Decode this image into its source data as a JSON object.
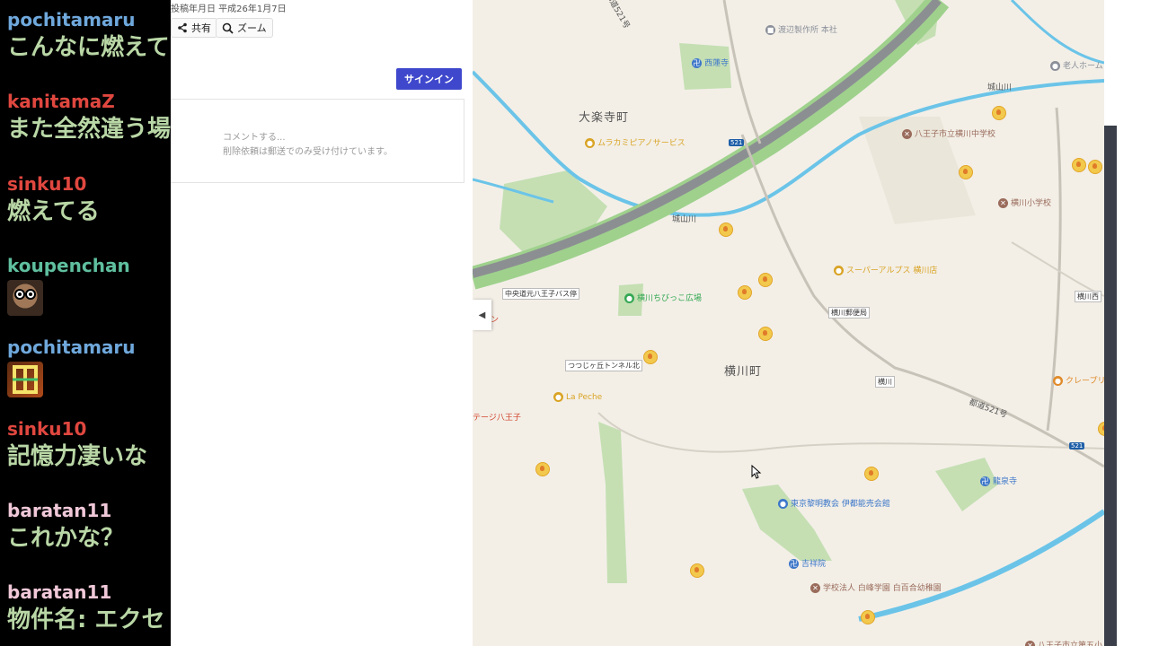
{
  "chat": {
    "messages": [
      {
        "user": "pochitamaru",
        "color": "#6fa8dc",
        "text": "こんなに燃えて"
      },
      {
        "user": "kanitamaZ",
        "color": "#e0473f",
        "text": "また全然違う場"
      },
      {
        "user": "sinku10",
        "color": "#e0473f",
        "text": "燃えてる"
      },
      {
        "user": "koupenchan",
        "color": "#5fbf9f",
        "emote": "face-emote"
      },
      {
        "user": "pochitamaru",
        "color": "#6fa8dc",
        "emote": "kanji-emote"
      },
      {
        "user": "sinku10",
        "color": "#e0473f",
        "text": "記憶力凄いな"
      },
      {
        "user": "baratan11",
        "color": "#f0c8d8",
        "text": "これかな？"
      },
      {
        "user": "baratan11",
        "color": "#f0c8d8",
        "text": "物件名: エクセ"
      }
    ]
  },
  "panel": {
    "date_text": "投稿年月日 平成26年1月7日",
    "share_label": "共有",
    "zoom_label": "ズーム",
    "signin_label": "サインイン",
    "comment_placeholder": "コメントする...",
    "comment_note": "削除依頼は郵送でのみ受け付けています。"
  },
  "map": {
    "areas": [
      "大楽寺町",
      "横川町"
    ],
    "roads": [
      "都道521号",
      "城山川",
      "城山川",
      "都道521号"
    ],
    "shields": [
      "521",
      "521"
    ],
    "bus_stops": [
      "中央道元八王子バス停",
      "つつじヶ丘トンネル北",
      "横川郵便局",
      "横川",
      "横川西"
    ],
    "pois": [
      {
        "name": "渡辺製作所 本社",
        "color": "#8a8f99",
        "glyph": "■"
      },
      {
        "name": "西蓮寺",
        "color": "#3d77c9",
        "glyph": "卍"
      },
      {
        "name": "老人ホーム",
        "color": "#8a8f99",
        "glyph": "●"
      },
      {
        "name": "ムラカミピアノサービス",
        "color": "#d9a324",
        "glyph": "●"
      },
      {
        "name": "八王子市立横川中学校",
        "color": "#9a6b5b",
        "glyph": "✕"
      },
      {
        "name": "横川小学校",
        "color": "#9a6b5b",
        "glyph": "✕"
      },
      {
        "name": "スーパーアルプス 横川店",
        "color": "#d9a324",
        "glyph": "●"
      },
      {
        "name": "横川ちびっこ広場",
        "color": "#34a853",
        "glyph": "●"
      },
      {
        "name": "クレープリ",
        "color": "#e08a2a",
        "glyph": "●"
      },
      {
        "name": "La Peche",
        "color": "#d9a324",
        "glyph": "●"
      },
      {
        "name": "テージ八王子",
        "color": "#d3452e",
        "glyph": ""
      },
      {
        "name": "龍泉寺",
        "color": "#3d77c9",
        "glyph": "卍"
      },
      {
        "name": "東京黎明教会 伊都能売会館",
        "color": "#3d77c9",
        "glyph": "●"
      },
      {
        "name": "吉祥院",
        "color": "#3d77c9",
        "glyph": "卍"
      },
      {
        "name": "学校法人 白峰学園 白百合幼稚園",
        "color": "#9a6b5b",
        "glyph": "✕"
      },
      {
        "name": "八王子市立第五小",
        "color": "#9a6b5b",
        "glyph": "✕"
      },
      {
        "name": "ン",
        "color": "#d3452e",
        "glyph": ""
      }
    ],
    "incident_markers": 15
  }
}
